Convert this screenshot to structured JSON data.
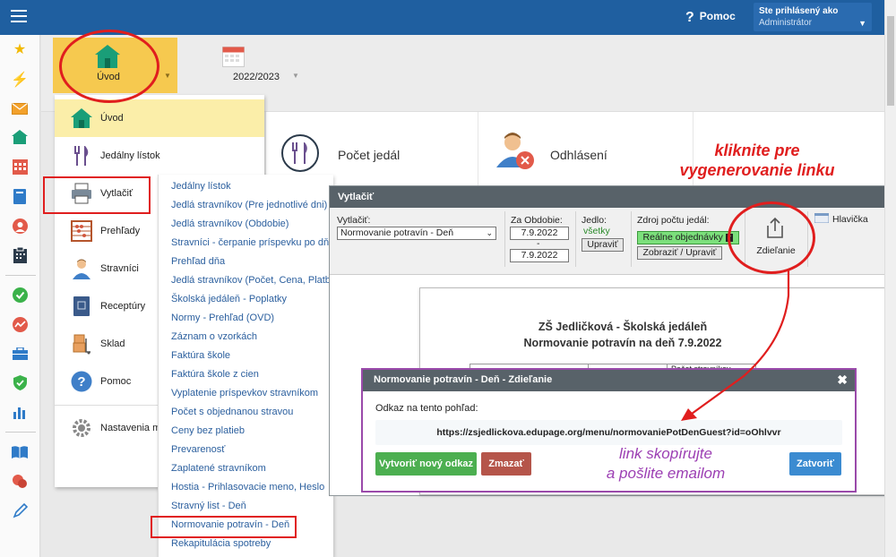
{
  "topbar": {
    "help_label": "Pomoc",
    "user_line1": "Ste prihlásený ako",
    "user_line2": "Administrátor"
  },
  "header": {
    "uvod_label": "Úvod",
    "year_label": "2022/2023"
  },
  "tiles": {
    "pocet_jedal": "Počet jedál",
    "odhlaseni": "Odhlásení"
  },
  "dropdown": {
    "items": [
      {
        "label": "Úvod",
        "icon": "home-icon"
      },
      {
        "label": "Jedálny lístok",
        "icon": "cutlery-icon"
      },
      {
        "label": "Vytlačiť",
        "icon": "printer-icon"
      },
      {
        "label": "Prehľady",
        "icon": "abacus-icon"
      },
      {
        "label": "Stravníci",
        "icon": "person-icon"
      },
      {
        "label": "Receptúry",
        "icon": "recipe-book-icon"
      },
      {
        "label": "Sklad",
        "icon": "boxes-icon"
      },
      {
        "label": "Pomoc",
        "icon": "help-icon"
      },
      {
        "label": "Nastavenia m",
        "icon": "gear-icon"
      }
    ]
  },
  "submenu": {
    "items": [
      "Jedálny lístok",
      "Jedlá stravníkov (Pre jednotlivé dni)",
      "Jedlá stravníkov (Obdobie)",
      "Stravníci - čerpanie príspevku po dňo",
      "Prehľad dňa",
      "Jedlá stravníkov (Počet, Cena, Platb",
      "Školská jedáleň - Poplatky",
      "Normy - Prehľad (OVD)",
      "Záznam o vzorkách",
      "Faktúra škole",
      "Faktúra škole z cien",
      "Vyplatenie príspevkov stravníkom",
      "Počet s objednanou stravou",
      "Ceny bez platieb",
      "Prevarenosť",
      "Zaplatené stravníkom",
      "Hostia - Prihlasovacie meno, Heslo",
      "Stravný list - Deň",
      "Normovanie potravín - Deň",
      "Rekapitulácia spotreby"
    ]
  },
  "vytlacit_panel": {
    "title": "Vytlačiť",
    "print_label": "Vytlačiť:",
    "print_value": "Normovanie potravín - Deň",
    "period_label": "Za Obdobie:",
    "date_from": "7.9.2022",
    "date_sep": "-",
    "date_to": "7.9.2022",
    "meal_label": "Jedlo:",
    "meal_value": "všetky",
    "edit_button": "Upraviť",
    "source_label": "Zdroj počtu jedál:",
    "source_value": "Reálne objednávky",
    "show_edit_button": "Zobraziť / Upraviť",
    "share_label": "Zdieľanie",
    "header_label": "Hlavička"
  },
  "document": {
    "line1": "ZŠ Jedličková - Školská jedáleň",
    "line2": "Normovanie potravín na deň 7.9.2022",
    "partial_cell": "Počet stravníkov"
  },
  "modal": {
    "title": "Normovanie potravín - Deň - Zdieľanie",
    "link_label": "Odkaz na tento pohľad:",
    "link_url": "https://zsjedlickova.edupage.org/menu/normovaniePotDenGuest?id=oOhlvvr",
    "create_button": "Vytvoriť nový odkaz",
    "delete_button": "Zmazať",
    "close_button": "Zatvoriť"
  },
  "annotations": {
    "click_line1": "kliknite pre",
    "click_line2": "vygenerovanie linku",
    "copy_line1": "link skopírujte",
    "copy_line2": "a pošlite emailom"
  },
  "colors": {
    "topbar": "#1f5fa0",
    "accent_yellow": "#f6c94f",
    "link_blue": "#2b5f9e",
    "annotation_red": "#e01e1e",
    "annotation_purple": "#9c3fb3",
    "green_button": "#4caf50",
    "delete_button": "#b5554a",
    "close_button": "#3b8bd1"
  }
}
